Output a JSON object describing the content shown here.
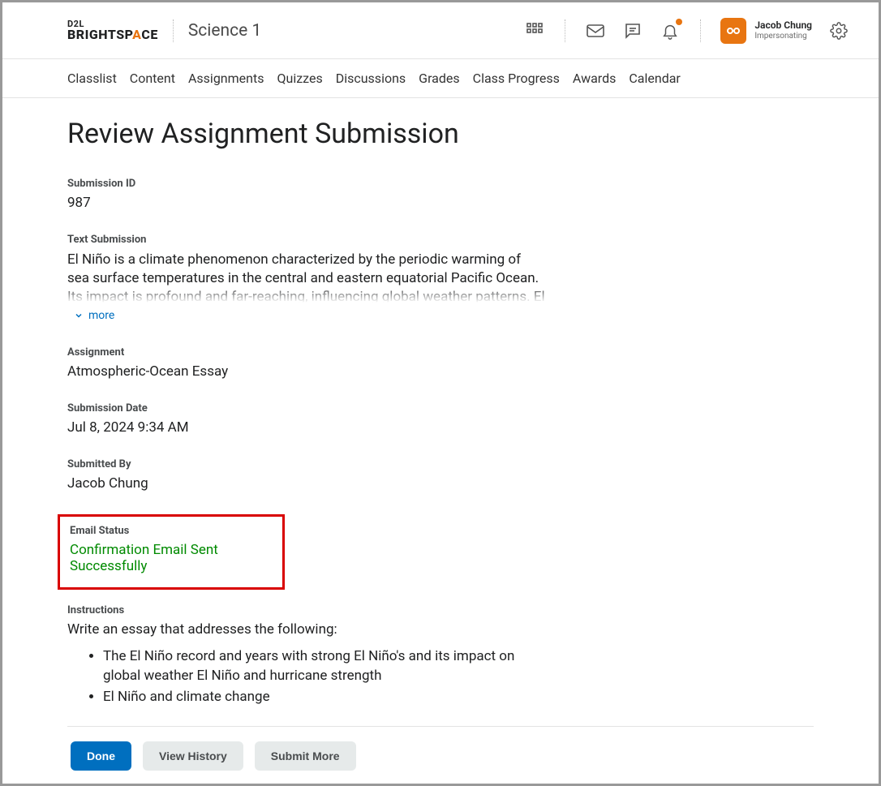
{
  "header": {
    "logo_line1": "D2L",
    "logo_line2_a": "BRIGHTSP",
    "logo_line2_accent": "A",
    "logo_line2_b": "CE",
    "course_title": "Science 1",
    "user_name": "Jacob Chung",
    "user_sub": "Impersonating"
  },
  "nav": {
    "items": [
      "Classlist",
      "Content",
      "Assignments",
      "Quizzes",
      "Discussions",
      "Grades",
      "Class Progress",
      "Awards",
      "Calendar"
    ]
  },
  "page": {
    "title": "Review Assignment Submission",
    "submission_id_label": "Submission ID",
    "submission_id": "987",
    "text_submission_label": "Text Submission",
    "text_submission": "El Niño is a climate phenomenon characterized by the periodic warming of sea surface temperatures in the central and eastern equatorial Pacific Ocean. Its impact is profound and far-reaching, influencing global weather patterns. El Niño often leads to",
    "more_label": "more",
    "assignment_label": "Assignment",
    "assignment": "Atmospheric-Ocean Essay",
    "submission_date_label": "Submission Date",
    "submission_date": "Jul 8, 2024 9:34 AM",
    "submitted_by_label": "Submitted By",
    "submitted_by": "Jacob Chung",
    "email_status_label": "Email Status",
    "email_status": "Confirmation Email Sent Successfully",
    "instructions_label": "Instructions",
    "instructions_intro": "Write an essay that addresses the following:",
    "instructions": [
      "The El Niño record and years with strong El Niño's and its impact on global weather El Niño and hurricane strength",
      "El Niño and climate change"
    ],
    "buttons": {
      "done": "Done",
      "view_history": "View History",
      "submit_more": "Submit More"
    }
  }
}
